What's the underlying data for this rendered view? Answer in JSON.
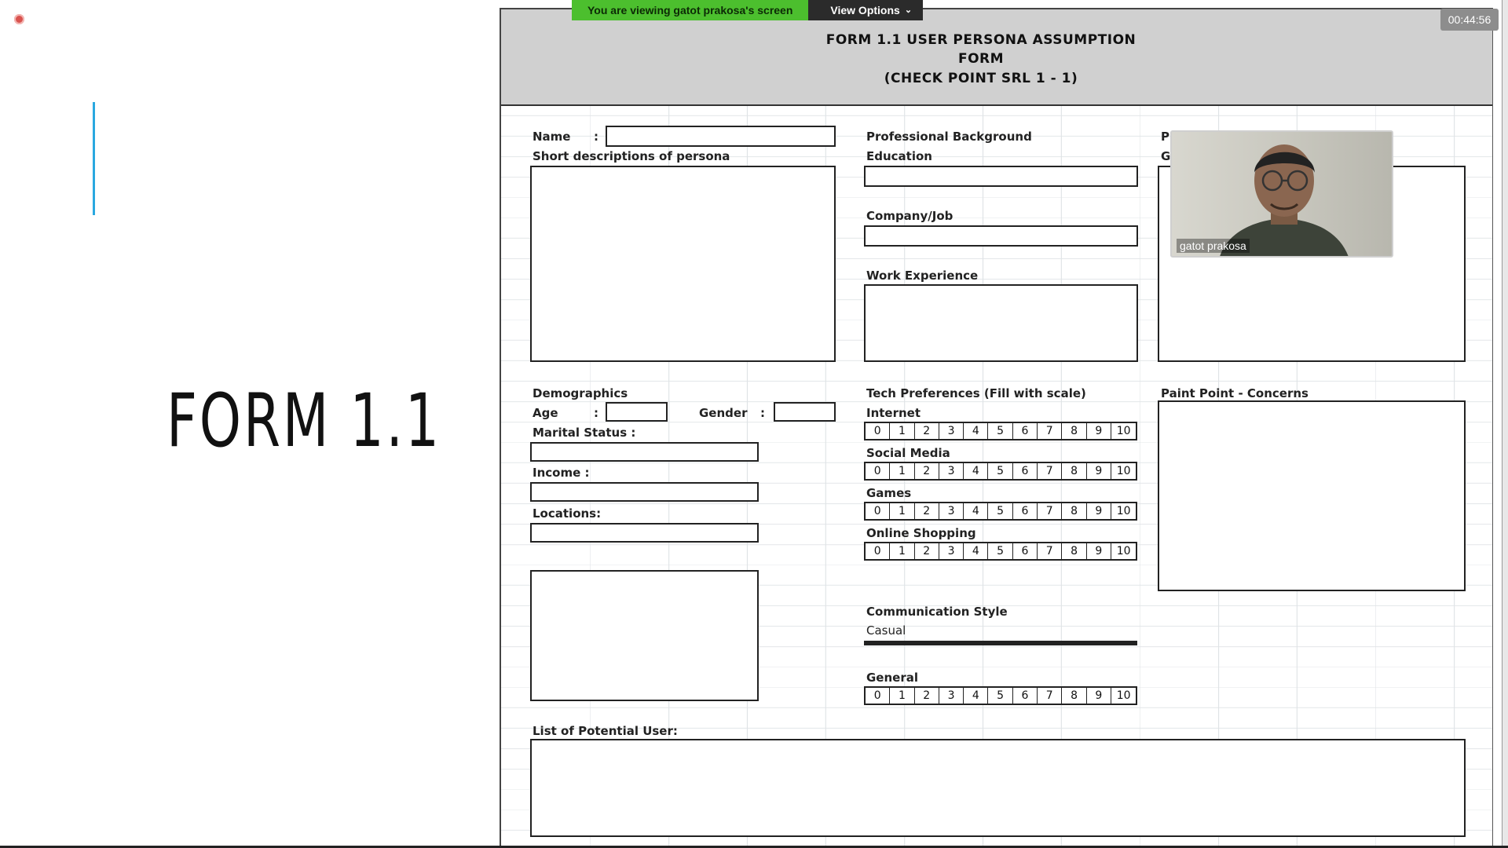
{
  "slide": {
    "title": "FORM 1.1"
  },
  "zoom": {
    "banner": "You are viewing gatot prakosa's screen",
    "view_options": "View Options",
    "timer": "00:44:56",
    "participant_name": "gatot prakosa"
  },
  "form": {
    "header_lines": [
      "FORM 1.1 USER PERSONA ASSUMPTION",
      "FORM",
      "(CHECK POINT SRL 1 - 1)"
    ],
    "name_label": "Name",
    "colon": ":",
    "short_desc_label": "Short descriptions of persona",
    "professional_background": "Professional Background",
    "education": "Education",
    "company_job": "Company/Job",
    "work_experience": "Work Experience",
    "partial_p": "P",
    "partial_g": "G",
    "demographics": "Demographics",
    "age": "Age",
    "gender": "Gender",
    "marital_status": "Marital Status :",
    "income": "Income :",
    "locations": "Locations:",
    "tech_preferences": "Tech Preferences (Fill with scale)",
    "internet": "Internet",
    "social_media": "Social Media",
    "games": "Games",
    "online_shopping": "Online Shopping",
    "communication_style": "Communication Style",
    "casual": "Casual",
    "general": "General",
    "paint_point": "Paint Point - Concerns",
    "potential_user": "List of Potential User:",
    "scale_values": [
      "0",
      "1",
      "2",
      "3",
      "4",
      "5",
      "6",
      "7",
      "8",
      "9",
      "10"
    ]
  }
}
